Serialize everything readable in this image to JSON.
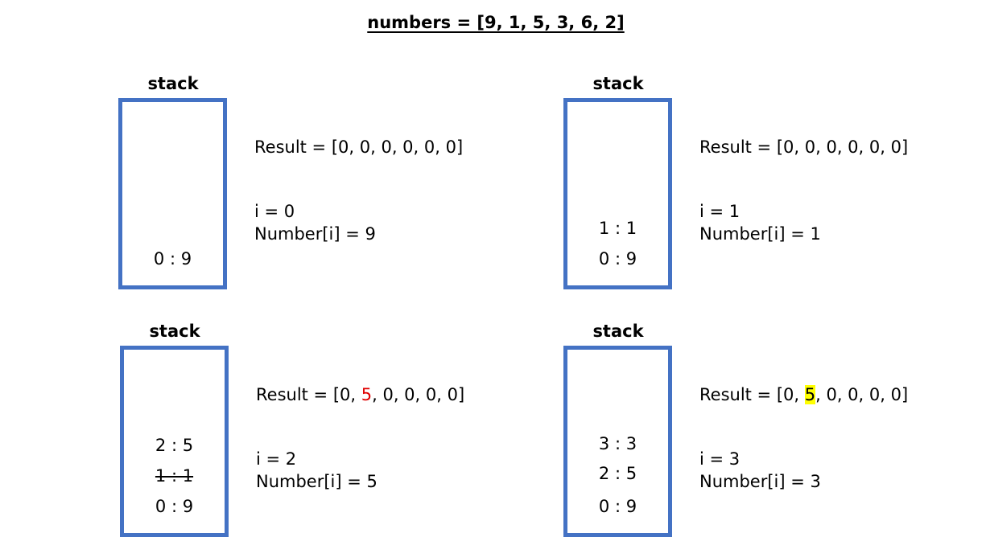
{
  "title": "numbers = [9, 1, 5, 3, 6, 2]",
  "panels": [
    {
      "stack_label": "stack",
      "entries": [
        "0 : 9"
      ],
      "result": {
        "prefix": "Result = [0, ",
        "highlight": "0",
        "suffix": ", 0, 0, 0, 0]"
      },
      "i_line": "i = 0",
      "number_line": "Number[i] = 9"
    },
    {
      "stack_label": "stack",
      "entries": [
        "1 : 1",
        "0 : 9"
      ],
      "result": {
        "prefix": "Result = [0, ",
        "highlight": "0",
        "suffix": ", 0, 0, 0, 0]"
      },
      "i_line": "i = 1",
      "number_line": "Number[i] = 1"
    },
    {
      "stack_label": "stack",
      "entries": [
        "2 : 5",
        "1 : 1",
        "0 : 9"
      ],
      "popped_entry": "1 : 1",
      "result": {
        "prefix": "Result = [0, ",
        "highlight": "5",
        "suffix": ", 0, 0, 0, 0]"
      },
      "highlight_color": "#e00000",
      "i_line": "i = 2",
      "number_line": "Number[i] = 5"
    },
    {
      "stack_label": "stack",
      "entries": [
        "3 : 3",
        "2 : 5",
        "0 : 9"
      ],
      "result": {
        "prefix": "Result = [0, ",
        "highlight": "5",
        "suffix": ", 0, 0, 0, 0]"
      },
      "highlight_background": "#ffff00",
      "i_line": "i = 3",
      "number_line": "Number[i] = 3"
    }
  ],
  "colors": {
    "stack_border": "#4472c4",
    "changed_value": "#e00000",
    "marker": "#ffff00"
  }
}
